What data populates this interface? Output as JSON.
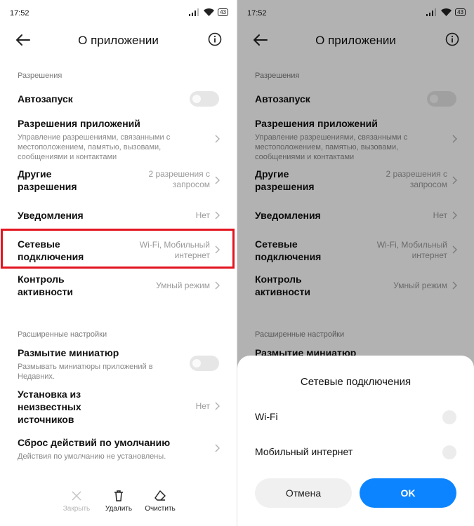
{
  "status": {
    "time": "17:52",
    "battery": "43"
  },
  "header": {
    "title": "О приложении"
  },
  "sections": {
    "permissions": "Разрешения",
    "advanced": "Расширенные настройки"
  },
  "rows": {
    "autostart": {
      "title": "Автозапуск"
    },
    "app_permissions": {
      "title": "Разрешения приложений",
      "subtitle": "Управление разрешениями, связанными с местоположением, памятью, вызовами, сообщениями и контактами"
    },
    "other_permissions": {
      "title_line1": "Другие",
      "title_line2": "разрешения",
      "value_line1": "2 разрешения с",
      "value_line2": "запросом"
    },
    "notifications": {
      "title": "Уведомления",
      "value": "Нет"
    },
    "network": {
      "title_line1": "Сетевые",
      "title_line2": "подключения",
      "value_line1": "Wi-Fi, Мобильный",
      "value_line2": "интернет"
    },
    "activity": {
      "title_line1": "Контроль",
      "title_line2": "активности",
      "value": "Умный режим"
    },
    "blur": {
      "title": "Размытие миниатюр",
      "subtitle": "Размывать миниатюры приложений в Недавних."
    },
    "install": {
      "title_line1": "Установка из",
      "title_line2": "неизвестных",
      "title_line3": "источников",
      "value": "Нет"
    },
    "reset": {
      "title": "Сброс действий по умолчанию",
      "subtitle": "Действия по умолчанию не установлены."
    }
  },
  "toolbar": {
    "close": "Закрыть",
    "delete": "Удалить",
    "clear": "Очистить"
  },
  "dialog": {
    "title": "Сетевые подключения",
    "options": [
      "Wi-Fi",
      "Мобильный интернет"
    ],
    "cancel": "Отмена",
    "ok": "OK"
  },
  "colors": {
    "accent": "#0d84ff",
    "highlight": "#e3141f"
  }
}
